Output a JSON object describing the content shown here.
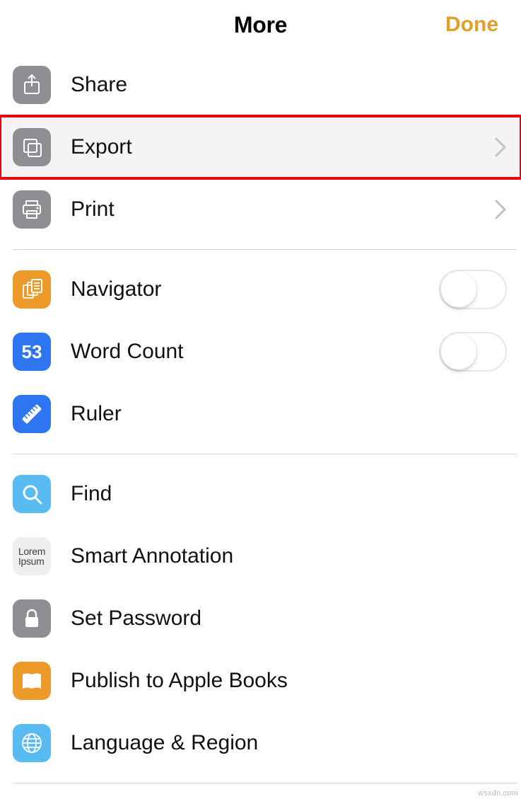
{
  "header": {
    "title": "More",
    "done_label": "Done"
  },
  "section1": {
    "share": {
      "label": "Share"
    },
    "export": {
      "label": "Export"
    },
    "print": {
      "label": "Print"
    }
  },
  "section2": {
    "navigator": {
      "label": "Navigator",
      "toggled": false
    },
    "word_count": {
      "label": "Word Count",
      "toggled": false,
      "badge": "53"
    },
    "ruler": {
      "label": "Ruler"
    }
  },
  "section3": {
    "find": {
      "label": "Find"
    },
    "smart_annotation": {
      "label": "Smart Annotation",
      "icon_text": "Lorem\nIpsum"
    },
    "set_password": {
      "label": "Set Password"
    },
    "publish": {
      "label": "Publish to Apple Books"
    },
    "language": {
      "label": "Language & Region"
    }
  },
  "watermark": "wsxdn.com"
}
